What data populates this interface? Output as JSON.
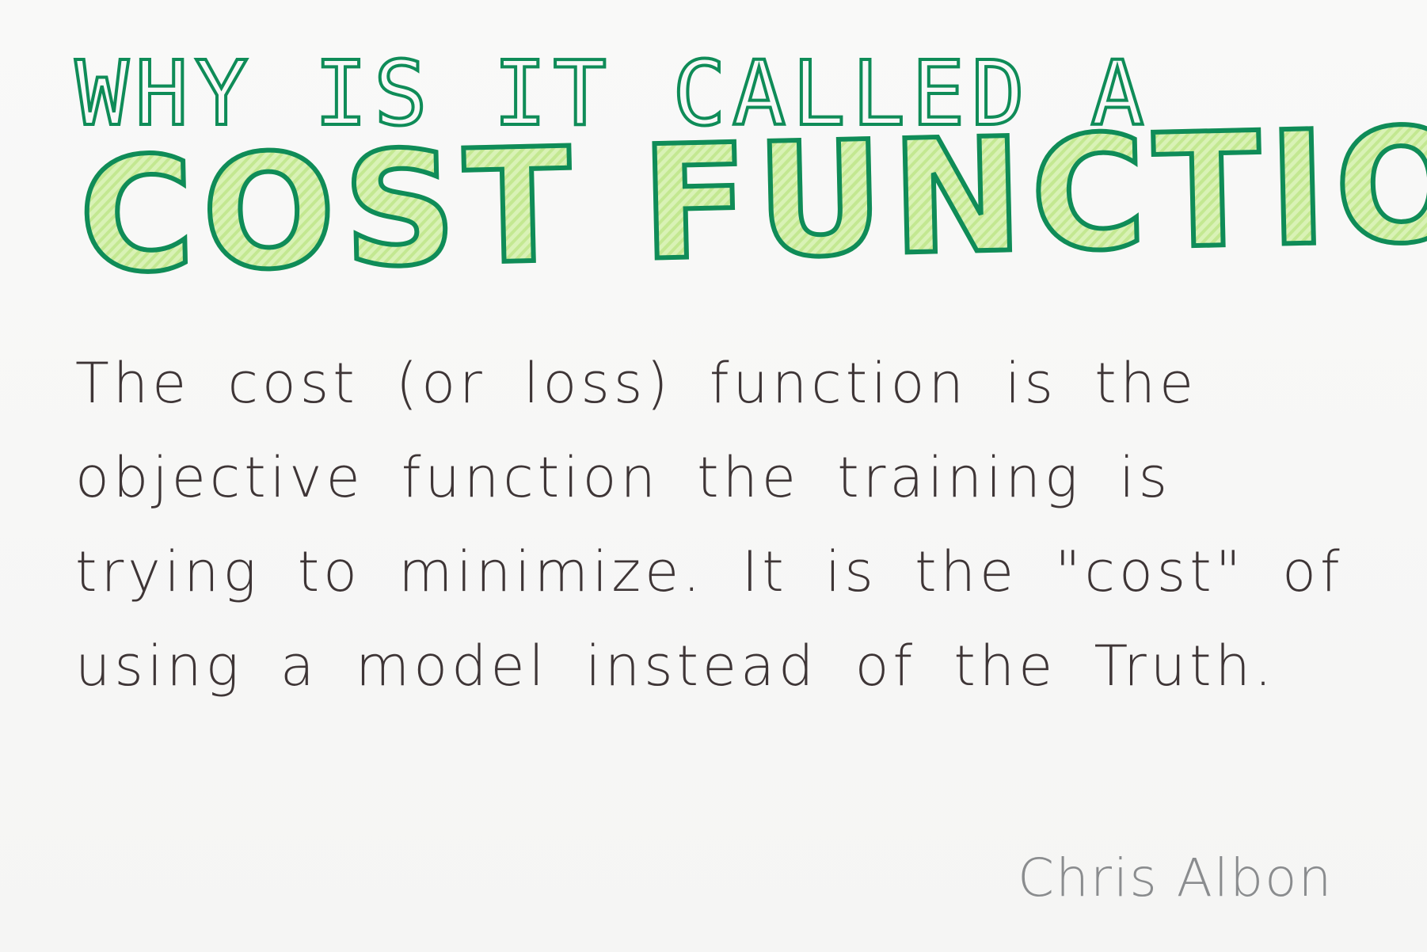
{
  "header": {
    "kicker": "WHY IS IT CALLED A",
    "headline": "COST FUNCTION"
  },
  "body": {
    "text": "The cost (or loss) function is the objective function the training is trying to minimize. It is the \"cost\" of using a model instead of the Truth."
  },
  "footer": {
    "author": "Chris Albon"
  },
  "colors": {
    "title_outline": "#0f8c58",
    "title_fill": "#c9ec9c",
    "body_ink": "#3e3536",
    "signature_ink": "#8a8c8e",
    "background": "#f7f7f6"
  }
}
